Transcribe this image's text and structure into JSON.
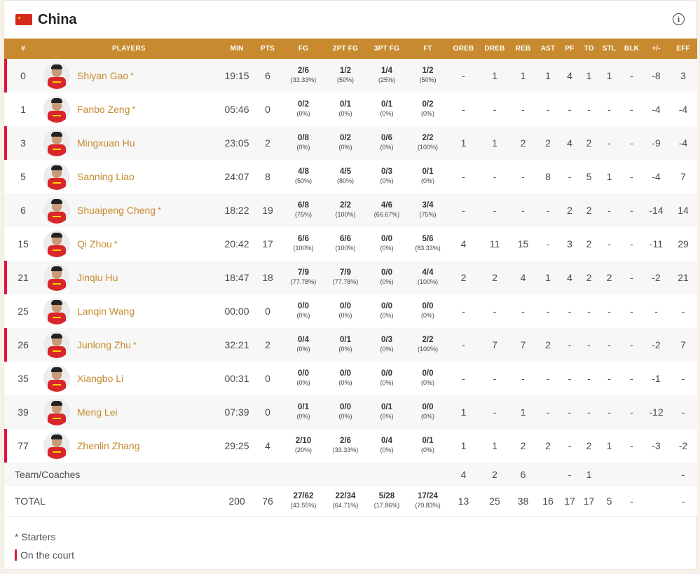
{
  "header": {
    "team": "China",
    "flag_icon": "china-flag-icon",
    "info_icon": "info-icon"
  },
  "colors": {
    "accent": "#c78a2e",
    "on_court": "#e0153a",
    "header_text": "#ffffff"
  },
  "columns": [
    "#",
    "PLAYERS",
    "MIN",
    "PTS",
    "FG",
    "2PT FG",
    "3PT FG",
    "FT",
    "OREB",
    "DREB",
    "REB",
    "AST",
    "PF",
    "TO",
    "STL",
    "BLK",
    "+/-",
    "EFF"
  ],
  "players": [
    {
      "num": "0",
      "name": "Shiyan Gao",
      "star": "*",
      "court": true,
      "min": "19:15",
      "pts": "6",
      "fg": "2/6",
      "fg_pct": "(33.33%)",
      "fg2": "1/2",
      "fg2_pct": "(50%)",
      "fg3": "1/4",
      "fg3_pct": "(25%)",
      "ft": "1/2",
      "ft_pct": "(50%)",
      "oreb": "-",
      "dreb": "1",
      "reb": "1",
      "ast": "1",
      "pf": "4",
      "to": "1",
      "stl": "1",
      "blk": "-",
      "pm": "-8",
      "eff": "3"
    },
    {
      "num": "1",
      "name": "Fanbo Zeng",
      "star": "*",
      "court": false,
      "min": "05:46",
      "pts": "0",
      "fg": "0/2",
      "fg_pct": "(0%)",
      "fg2": "0/1",
      "fg2_pct": "(0%)",
      "fg3": "0/1",
      "fg3_pct": "(0%)",
      "ft": "0/2",
      "ft_pct": "(0%)",
      "oreb": "-",
      "dreb": "-",
      "reb": "-",
      "ast": "-",
      "pf": "-",
      "to": "-",
      "stl": "-",
      "blk": "-",
      "pm": "-4",
      "eff": "-4"
    },
    {
      "num": "3",
      "name": "Mingxuan Hu",
      "star": "",
      "court": true,
      "min": "23:05",
      "pts": "2",
      "fg": "0/8",
      "fg_pct": "(0%)",
      "fg2": "0/2",
      "fg2_pct": "(0%)",
      "fg3": "0/6",
      "fg3_pct": "(0%)",
      "ft": "2/2",
      "ft_pct": "(100%)",
      "oreb": "1",
      "dreb": "1",
      "reb": "2",
      "ast": "2",
      "pf": "4",
      "to": "2",
      "stl": "-",
      "blk": "-",
      "pm": "-9",
      "eff": "-4"
    },
    {
      "num": "5",
      "name": "Sanning Liao",
      "star": "",
      "court": false,
      "min": "24:07",
      "pts": "8",
      "fg": "4/8",
      "fg_pct": "(50%)",
      "fg2": "4/5",
      "fg2_pct": "(80%)",
      "fg3": "0/3",
      "fg3_pct": "(0%)",
      "ft": "0/1",
      "ft_pct": "(0%)",
      "oreb": "-",
      "dreb": "-",
      "reb": "-",
      "ast": "8",
      "pf": "-",
      "to": "5",
      "stl": "1",
      "blk": "-",
      "pm": "-4",
      "eff": "7"
    },
    {
      "num": "6",
      "name": "Shuaipeng Cheng",
      "star": "*",
      "court": false,
      "min": "18:22",
      "pts": "19",
      "fg": "6/8",
      "fg_pct": "(75%)",
      "fg2": "2/2",
      "fg2_pct": "(100%)",
      "fg3": "4/6",
      "fg3_pct": "(66.67%)",
      "ft": "3/4",
      "ft_pct": "(75%)",
      "oreb": "-",
      "dreb": "-",
      "reb": "-",
      "ast": "-",
      "pf": "2",
      "to": "2",
      "stl": "-",
      "blk": "-",
      "pm": "-14",
      "eff": "14"
    },
    {
      "num": "15",
      "name": "Qi Zhou",
      "star": "*",
      "court": false,
      "min": "20:42",
      "pts": "17",
      "fg": "6/6",
      "fg_pct": "(100%)",
      "fg2": "6/6",
      "fg2_pct": "(100%)",
      "fg3": "0/0",
      "fg3_pct": "(0%)",
      "ft": "5/6",
      "ft_pct": "(83.33%)",
      "oreb": "4",
      "dreb": "11",
      "reb": "15",
      "ast": "-",
      "pf": "3",
      "to": "2",
      "stl": "-",
      "blk": "-",
      "pm": "-11",
      "eff": "29"
    },
    {
      "num": "21",
      "name": "Jinqiu Hu",
      "star": "",
      "court": true,
      "min": "18:47",
      "pts": "18",
      "fg": "7/9",
      "fg_pct": "(77.78%)",
      "fg2": "7/9",
      "fg2_pct": "(77.78%)",
      "fg3": "0/0",
      "fg3_pct": "(0%)",
      "ft": "4/4",
      "ft_pct": "(100%)",
      "oreb": "2",
      "dreb": "2",
      "reb": "4",
      "ast": "1",
      "pf": "4",
      "to": "2",
      "stl": "2",
      "blk": "-",
      "pm": "-2",
      "eff": "21"
    },
    {
      "num": "25",
      "name": "Lanqin Wang",
      "star": "",
      "court": false,
      "min": "00:00",
      "pts": "0",
      "fg": "0/0",
      "fg_pct": "(0%)",
      "fg2": "0/0",
      "fg2_pct": "(0%)",
      "fg3": "0/0",
      "fg3_pct": "(0%)",
      "ft": "0/0",
      "ft_pct": "(0%)",
      "oreb": "-",
      "dreb": "-",
      "reb": "-",
      "ast": "-",
      "pf": "-",
      "to": "-",
      "stl": "-",
      "blk": "-",
      "pm": "-",
      "eff": "-"
    },
    {
      "num": "26",
      "name": "Junlong Zhu",
      "star": "*",
      "court": true,
      "min": "32:21",
      "pts": "2",
      "fg": "0/4",
      "fg_pct": "(0%)",
      "fg2": "0/1",
      "fg2_pct": "(0%)",
      "fg3": "0/3",
      "fg3_pct": "(0%)",
      "ft": "2/2",
      "ft_pct": "(100%)",
      "oreb": "-",
      "dreb": "7",
      "reb": "7",
      "ast": "2",
      "pf": "-",
      "to": "-",
      "stl": "-",
      "blk": "-",
      "pm": "-2",
      "eff": "7"
    },
    {
      "num": "35",
      "name": "Xiangbo Li",
      "star": "",
      "court": false,
      "min": "00:31",
      "pts": "0",
      "fg": "0/0",
      "fg_pct": "(0%)",
      "fg2": "0/0",
      "fg2_pct": "(0%)",
      "fg3": "0/0",
      "fg3_pct": "(0%)",
      "ft": "0/0",
      "ft_pct": "(0%)",
      "oreb": "-",
      "dreb": "-",
      "reb": "-",
      "ast": "-",
      "pf": "-",
      "to": "-",
      "stl": "-",
      "blk": "-",
      "pm": "-1",
      "eff": "-"
    },
    {
      "num": "39",
      "name": "Meng Lei",
      "star": "",
      "court": false,
      "min": "07:39",
      "pts": "0",
      "fg": "0/1",
      "fg_pct": "(0%)",
      "fg2": "0/0",
      "fg2_pct": "(0%)",
      "fg3": "0/1",
      "fg3_pct": "(0%)",
      "ft": "0/0",
      "ft_pct": "(0%)",
      "oreb": "1",
      "dreb": "-",
      "reb": "1",
      "ast": "-",
      "pf": "-",
      "to": "-",
      "stl": "-",
      "blk": "-",
      "pm": "-12",
      "eff": "-"
    },
    {
      "num": "77",
      "name": "Zhenlin Zhang",
      "star": "",
      "court": true,
      "min": "29:25",
      "pts": "4",
      "fg": "2/10",
      "fg_pct": "(20%)",
      "fg2": "2/6",
      "fg2_pct": "(33.33%)",
      "fg3": "0/4",
      "fg3_pct": "(0%)",
      "ft": "0/1",
      "ft_pct": "(0%)",
      "oreb": "1",
      "dreb": "1",
      "reb": "2",
      "ast": "2",
      "pf": "-",
      "to": "2",
      "stl": "1",
      "blk": "-",
      "pm": "-3",
      "eff": "-2"
    }
  ],
  "team_row": {
    "label": "Team/Coaches",
    "oreb": "4",
    "dreb": "2",
    "reb": "6",
    "ast": "",
    "pf": "-",
    "to": "1",
    "stl": "",
    "blk": "",
    "pm": "",
    "eff": "-"
  },
  "total_row": {
    "label": "TOTAL",
    "min": "200",
    "pts": "76",
    "fg": "27/62",
    "fg_pct": "(43.55%)",
    "fg2": "22/34",
    "fg2_pct": "(64.71%)",
    "fg3": "5/28",
    "fg3_pct": "(17.86%)",
    "ft": "17/24",
    "ft_pct": "(70.83%)",
    "oreb": "13",
    "dreb": "25",
    "reb": "38",
    "ast": "16",
    "pf": "17",
    "to": "17",
    "stl": "5",
    "blk": "-",
    "pm": "",
    "eff": "-"
  },
  "legend": {
    "starters": "* Starters",
    "on_court": "On the court"
  }
}
